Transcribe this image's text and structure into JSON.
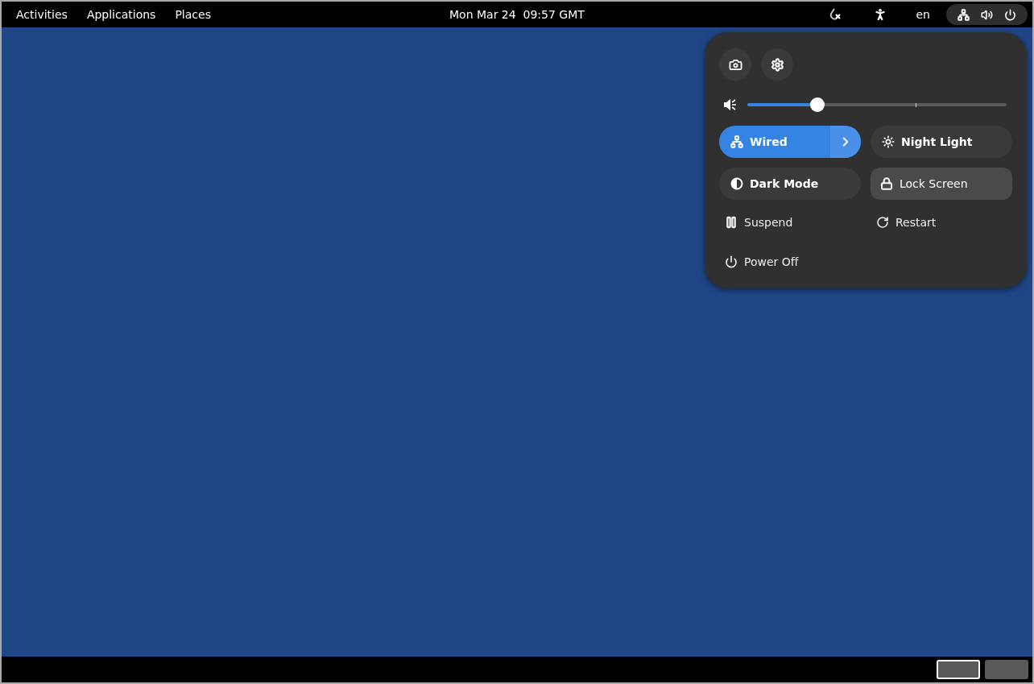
{
  "top_bar": {
    "menus": [
      {
        "label": "Activities"
      },
      {
        "label": "Applications"
      },
      {
        "label": "Places"
      }
    ],
    "clock": "Mon Mar 24  09:57 GMT",
    "keyboard_layout": "en"
  },
  "quick_settings": {
    "volume": {
      "level": 0.27
    },
    "toggles": [
      {
        "label": "Wired",
        "kind": "menu-toggle",
        "on": true
      },
      {
        "label": "Night Light",
        "kind": "toggle",
        "on": false
      },
      {
        "label": "Dark Mode",
        "kind": "toggle",
        "on": false
      },
      {
        "label": "Lock Screen",
        "kind": "action"
      }
    ],
    "actions": [
      {
        "label": "Suspend",
        "kind": "suspend"
      },
      {
        "label": "Restart",
        "kind": "restart"
      },
      {
        "label": "Power Off",
        "kind": "power"
      }
    ]
  },
  "workspaces": [
    {
      "selected": true
    },
    {
      "selected": false
    }
  ]
}
